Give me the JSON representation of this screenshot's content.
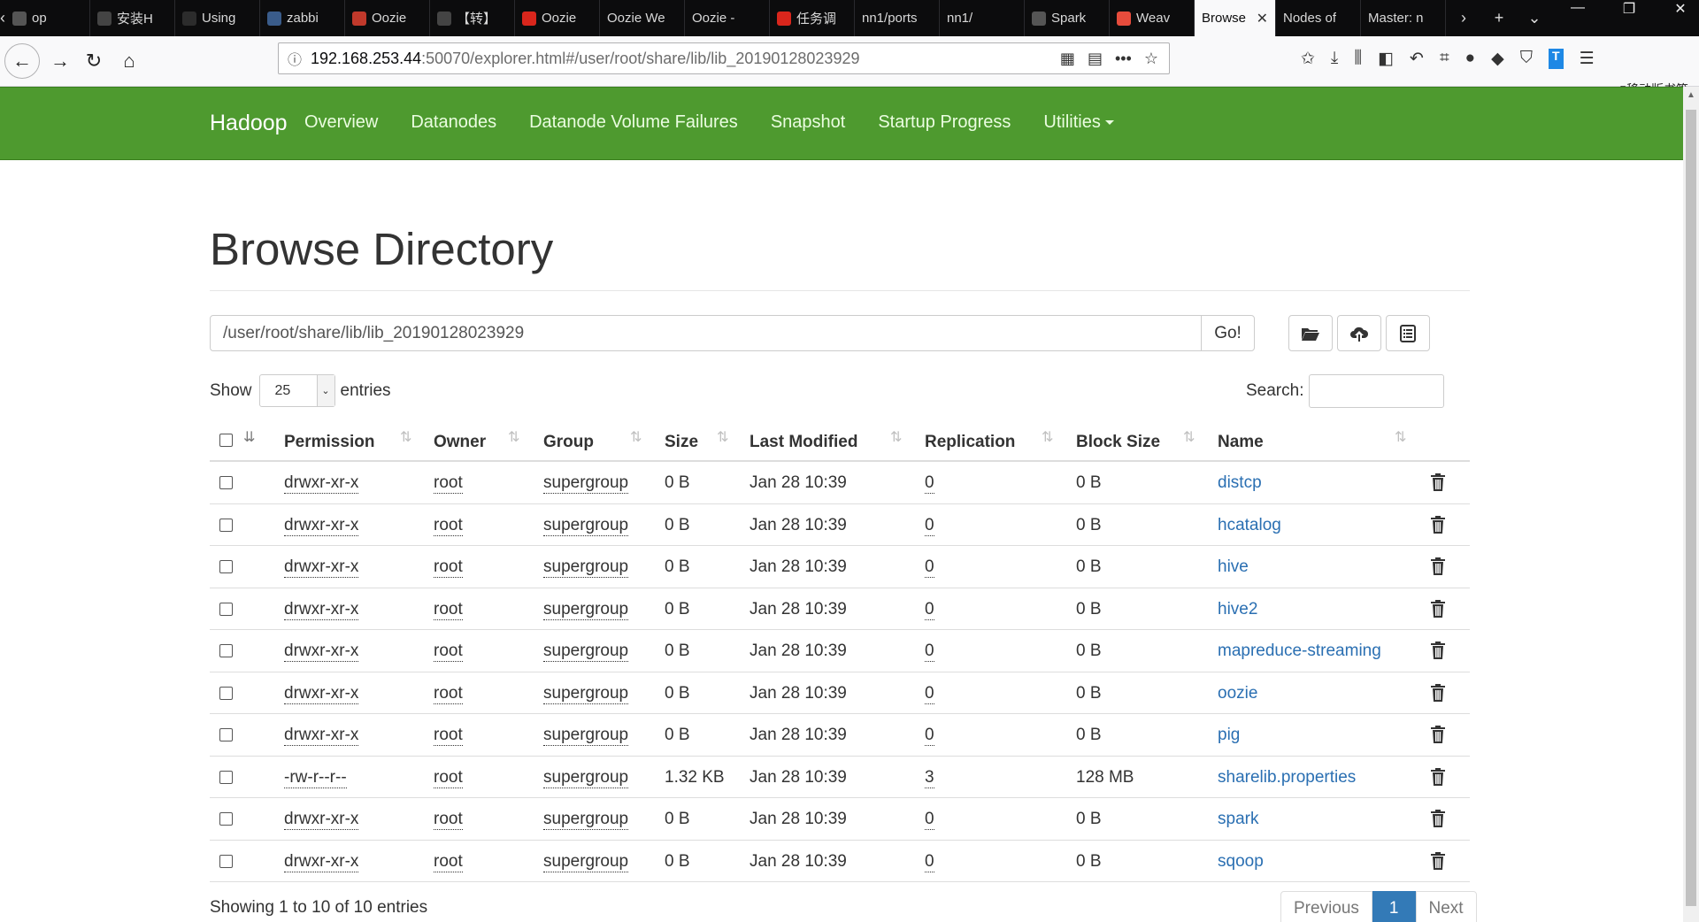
{
  "browser": {
    "tabs": [
      {
        "title": "op",
        "fav_color": "#555"
      },
      {
        "title": "安装H",
        "fav_color": "#444"
      },
      {
        "title": "Using",
        "fav_color": "#2c2c2c"
      },
      {
        "title": "zabbi",
        "fav_color": "#3a5c8a"
      },
      {
        "title": "Oozie",
        "fav_color": "#c0392b"
      },
      {
        "title": "【转】",
        "fav_color": "#444"
      },
      {
        "title": "Oozie",
        "fav_color": "#d9261c"
      },
      {
        "title": "Oozie We",
        "fav_color": ""
      },
      {
        "title": "Oozie -",
        "fav_color": ""
      },
      {
        "title": "任务调",
        "fav_color": "#d9261c"
      },
      {
        "title": "nn1/ports",
        "fav_color": ""
      },
      {
        "title": "nn1/",
        "fav_color": ""
      },
      {
        "title": "Spark",
        "fav_color": "#555"
      },
      {
        "title": "Weav",
        "fav_color": "#e74c3c"
      },
      {
        "title": "Browse",
        "fav_color": ""
      },
      {
        "title": "Nodes of",
        "fav_color": ""
      },
      {
        "title": "Master: n",
        "fav_color": ""
      }
    ],
    "active_tab_index": 14,
    "url_host": "192.168.253.44",
    "url_path": ":50070/explorer.html#/user/root/share/lib/lib_20190128023929",
    "mobile_bookmarks": "移动版书签"
  },
  "hadoop_nav": {
    "brand": "Hadoop",
    "links": [
      "Overview",
      "Datanodes",
      "Datanode Volume Failures",
      "Snapshot",
      "Startup Progress",
      "Utilities"
    ]
  },
  "page": {
    "title": "Browse Directory",
    "path_value": "/user/root/share/lib/lib_20190128023929",
    "go_label": "Go!",
    "show_label": "Show",
    "entries_value": "25",
    "entries_label": "entries",
    "search_label": "Search:",
    "columns": [
      "Permission",
      "Owner",
      "Group",
      "Size",
      "Last Modified",
      "Replication",
      "Block Size",
      "Name"
    ],
    "rows": [
      {
        "perm": "drwxr-xr-x",
        "owner": "root",
        "group": "supergroup",
        "size": "0 B",
        "modified": "Jan 28 10:39",
        "replication": "0",
        "block": "0 B",
        "name": "distcp"
      },
      {
        "perm": "drwxr-xr-x",
        "owner": "root",
        "group": "supergroup",
        "size": "0 B",
        "modified": "Jan 28 10:39",
        "replication": "0",
        "block": "0 B",
        "name": "hcatalog"
      },
      {
        "perm": "drwxr-xr-x",
        "owner": "root",
        "group": "supergroup",
        "size": "0 B",
        "modified": "Jan 28 10:39",
        "replication": "0",
        "block": "0 B",
        "name": "hive"
      },
      {
        "perm": "drwxr-xr-x",
        "owner": "root",
        "group": "supergroup",
        "size": "0 B",
        "modified": "Jan 28 10:39",
        "replication": "0",
        "block": "0 B",
        "name": "hive2"
      },
      {
        "perm": "drwxr-xr-x",
        "owner": "root",
        "group": "supergroup",
        "size": "0 B",
        "modified": "Jan 28 10:39",
        "replication": "0",
        "block": "0 B",
        "name": "mapreduce-streaming"
      },
      {
        "perm": "drwxr-xr-x",
        "owner": "root",
        "group": "supergroup",
        "size": "0 B",
        "modified": "Jan 28 10:39",
        "replication": "0",
        "block": "0 B",
        "name": "oozie"
      },
      {
        "perm": "drwxr-xr-x",
        "owner": "root",
        "group": "supergroup",
        "size": "0 B",
        "modified": "Jan 28 10:39",
        "replication": "0",
        "block": "0 B",
        "name": "pig"
      },
      {
        "perm": "-rw-r--r--",
        "owner": "root",
        "group": "supergroup",
        "size": "1.32 KB",
        "modified": "Jan 28 10:39",
        "replication": "3",
        "block": "128 MB",
        "name": "sharelib.properties"
      },
      {
        "perm": "drwxr-xr-x",
        "owner": "root",
        "group": "supergroup",
        "size": "0 B",
        "modified": "Jan 28 10:39",
        "replication": "0",
        "block": "0 B",
        "name": "spark"
      },
      {
        "perm": "drwxr-xr-x",
        "owner": "root",
        "group": "supergroup",
        "size": "0 B",
        "modified": "Jan 28 10:39",
        "replication": "0",
        "block": "0 B",
        "name": "sqoop"
      }
    ],
    "footer_info": "Showing 1 to 10 of 10 entries",
    "pager": {
      "previous": "Previous",
      "current": "1",
      "next": "Next"
    }
  },
  "colors": {
    "hadoop_green": "#4e9a2f",
    "link_blue": "#2a6fb2",
    "pager_active": "#337ab7"
  }
}
